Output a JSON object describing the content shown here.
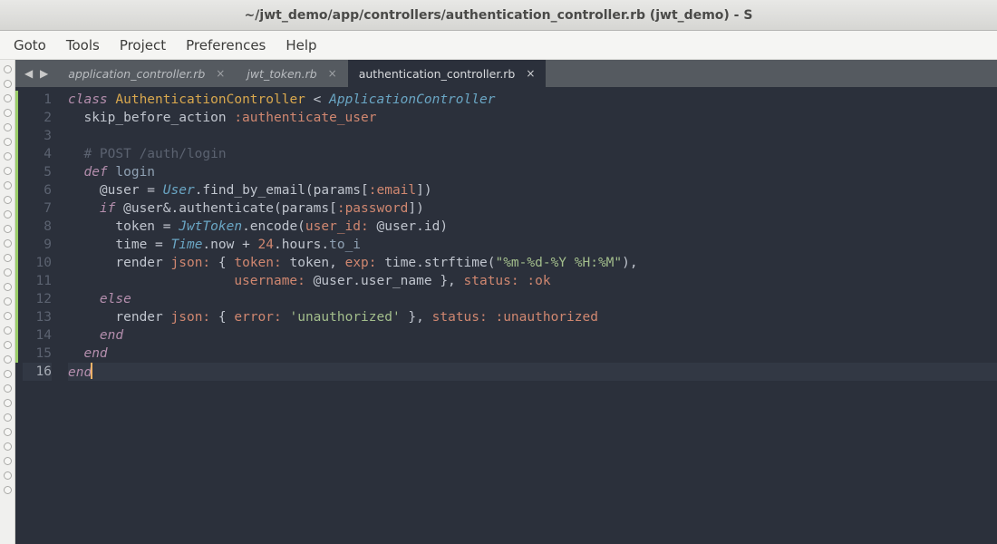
{
  "window": {
    "title": "~/jwt_demo/app/controllers/authentication_controller.rb (jwt_demo) - S"
  },
  "menu": {
    "items": [
      "Goto",
      "Tools",
      "Project",
      "Preferences",
      "Help"
    ]
  },
  "tabs": {
    "nav_arrows": "◀ ▶",
    "items": [
      {
        "label": "application_controller.rb",
        "active": false,
        "close": "×"
      },
      {
        "label": "jwt_token.rb",
        "active": false,
        "close": "×"
      },
      {
        "label": "authentication_controller.rb",
        "active": true,
        "close": "×"
      }
    ]
  },
  "editor": {
    "line_count": 16,
    "current_line": 16,
    "lines": {
      "1": [
        {
          "t": "class ",
          "c": "kw"
        },
        {
          "t": "AuthenticationController",
          "c": "cls"
        },
        {
          "t": " < ",
          "c": "punc"
        },
        {
          "t": "ApplicationController",
          "c": "typ"
        }
      ],
      "2": [
        {
          "t": "  skip_before_action ",
          "c": "punc"
        },
        {
          "t": ":authenticate_user",
          "c": "sym"
        }
      ],
      "3": [
        {
          "t": "",
          "c": "punc"
        }
      ],
      "4": [
        {
          "t": "  ",
          "c": "punc"
        },
        {
          "t": "# POST /auth/login",
          "c": "cmt"
        }
      ],
      "5": [
        {
          "t": "  ",
          "c": "punc"
        },
        {
          "t": "def ",
          "c": "def"
        },
        {
          "t": "login",
          "c": "fn"
        }
      ],
      "6": [
        {
          "t": "    ",
          "c": "punc"
        },
        {
          "t": "@user",
          "c": "ivar"
        },
        {
          "t": " = ",
          "c": "punc"
        },
        {
          "t": "User",
          "c": "typ"
        },
        {
          "t": ".find_by_email(params[",
          "c": "punc"
        },
        {
          "t": ":email",
          "c": "sym"
        },
        {
          "t": "])",
          "c": "punc"
        }
      ],
      "7": [
        {
          "t": "    ",
          "c": "punc"
        },
        {
          "t": "if ",
          "c": "kw"
        },
        {
          "t": "@user",
          "c": "ivar"
        },
        {
          "t": "&.authenticate(params[",
          "c": "punc"
        },
        {
          "t": ":password",
          "c": "sym"
        },
        {
          "t": "])",
          "c": "punc"
        }
      ],
      "8": [
        {
          "t": "      token = ",
          "c": "punc"
        },
        {
          "t": "JwtToken",
          "c": "typ"
        },
        {
          "t": ".encode(",
          "c": "punc"
        },
        {
          "t": "user_id:",
          "c": "sym"
        },
        {
          "t": " ",
          "c": "punc"
        },
        {
          "t": "@user",
          "c": "ivar"
        },
        {
          "t": ".id)",
          "c": "punc"
        }
      ],
      "9": [
        {
          "t": "      time = ",
          "c": "punc"
        },
        {
          "t": "Time",
          "c": "typ"
        },
        {
          "t": ".now + ",
          "c": "punc"
        },
        {
          "t": "24",
          "c": "num"
        },
        {
          "t": ".hours.",
          "c": "punc"
        },
        {
          "t": "to_i",
          "c": "fn"
        }
      ],
      "10": [
        {
          "t": "      render ",
          "c": "punc"
        },
        {
          "t": "json:",
          "c": "sym"
        },
        {
          "t": " { ",
          "c": "punc"
        },
        {
          "t": "token:",
          "c": "sym"
        },
        {
          "t": " token, ",
          "c": "punc"
        },
        {
          "t": "exp:",
          "c": "sym"
        },
        {
          "t": " time.strftime(",
          "c": "punc"
        },
        {
          "t": "\"%m-%d-%Y %H:%M\"",
          "c": "str"
        },
        {
          "t": "),",
          "c": "punc"
        }
      ],
      "11": [
        {
          "t": "                     ",
          "c": "punc"
        },
        {
          "t": "username:",
          "c": "sym"
        },
        {
          "t": " ",
          "c": "punc"
        },
        {
          "t": "@user",
          "c": "ivar"
        },
        {
          "t": ".user_name }, ",
          "c": "punc"
        },
        {
          "t": "status:",
          "c": "sym"
        },
        {
          "t": " ",
          "c": "punc"
        },
        {
          "t": ":ok",
          "c": "sym"
        }
      ],
      "12": [
        {
          "t": "    ",
          "c": "punc"
        },
        {
          "t": "else",
          "c": "kw"
        }
      ],
      "13": [
        {
          "t": "      render ",
          "c": "punc"
        },
        {
          "t": "json:",
          "c": "sym"
        },
        {
          "t": " { ",
          "c": "punc"
        },
        {
          "t": "error:",
          "c": "sym"
        },
        {
          "t": " ",
          "c": "punc"
        },
        {
          "t": "'unauthorized'",
          "c": "str"
        },
        {
          "t": " }, ",
          "c": "punc"
        },
        {
          "t": "status:",
          "c": "sym"
        },
        {
          "t": " ",
          "c": "punc"
        },
        {
          "t": ":unauthorized",
          "c": "sym"
        }
      ],
      "14": [
        {
          "t": "    ",
          "c": "punc"
        },
        {
          "t": "end",
          "c": "kw"
        }
      ],
      "15": [
        {
          "t": "  ",
          "c": "punc"
        },
        {
          "t": "end",
          "c": "kw"
        }
      ],
      "16": [
        {
          "t": "end",
          "c": "kw"
        }
      ]
    }
  }
}
